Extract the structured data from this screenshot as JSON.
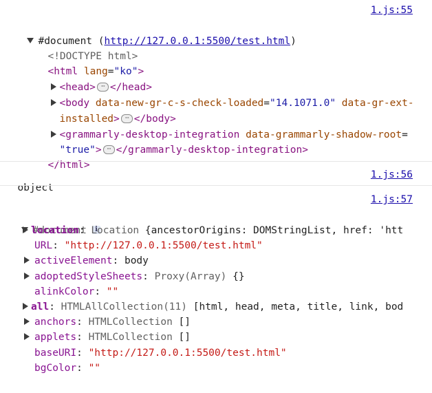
{
  "entries": {
    "first": {
      "source": "1.js:55",
      "root_label": "#document (",
      "root_url": "http://127.0.0.1:5500/test.html",
      "root_close": ")",
      "doctype": "<!DOCTYPE html>",
      "html_open_tag": "<html",
      "html_lang_attr": " lang",
      "html_lang_eq": "=",
      "html_lang_val": "\"ko\"",
      "html_open_end": ">",
      "head_open": "<head>",
      "head_ellipsis": "···",
      "head_close": "</head>",
      "body_open": "<body",
      "body_attr1": " data-new-gr-c-s-check-loaded",
      "body_attr1_eq": "=",
      "body_attr1_val": "\"14.1071.0\"",
      "body_attr2": " data-gr-ext-",
      "body_attr2_cont": "installed",
      "body_open_end": ">",
      "body_ellipsis": "···",
      "body_close": "</body>",
      "gram_open": "<grammarly-desktop-integration",
      "gram_attr": " data-grammarly-shadow-root",
      "gram_eq": "=",
      "gram_val": "\"true\"",
      "gram_open_end": ">",
      "gram_ellipsis": "···",
      "gram_close": "</grammarly-desktop-integration>",
      "html_close": "</html>"
    },
    "second": {
      "source": "1.js:56",
      "text": "object"
    },
    "third": {
      "source": "1.js:57",
      "root_label": "#document",
      "info_badge": "i",
      "properties": [
        {
          "name": "location",
          "sep": ": ",
          "cls": "Location ",
          "rest": "{ancestorOrigins: DOMStringList, href: 'htt",
          "expandable": true,
          "bold": true,
          "tight": true
        },
        {
          "name": "URL",
          "sep": ": ",
          "str": "\"http://127.0.0.1:5500/test.html\"",
          "expandable": false
        },
        {
          "name": "activeElement",
          "sep": ": ",
          "plain": "body",
          "expandable": true
        },
        {
          "name": "adoptedStyleSheets",
          "sep": ": ",
          "cls": "Proxy(Array) ",
          "rest": "{}",
          "expandable": true
        },
        {
          "name": "alinkColor",
          "sep": ": ",
          "str": "\"\"",
          "expandable": false
        },
        {
          "name": "all",
          "sep": ": ",
          "cls": "HTMLAllCollection(11) ",
          "rest": "[html, head, meta, title, link, bod",
          "expandable": true,
          "bold": true,
          "tight": true
        },
        {
          "name": "anchors",
          "sep": ": ",
          "cls": "HTMLCollection ",
          "rest": "[]",
          "expandable": true
        },
        {
          "name": "applets",
          "sep": ": ",
          "cls": "HTMLCollection ",
          "rest": "[]",
          "expandable": true
        },
        {
          "name": "baseURI",
          "sep": ": ",
          "str": "\"http://127.0.0.1:5500/test.html\"",
          "expandable": false
        },
        {
          "name": "bgColor",
          "sep": ": ",
          "str": "\"\"",
          "expandable": false
        }
      ]
    }
  }
}
